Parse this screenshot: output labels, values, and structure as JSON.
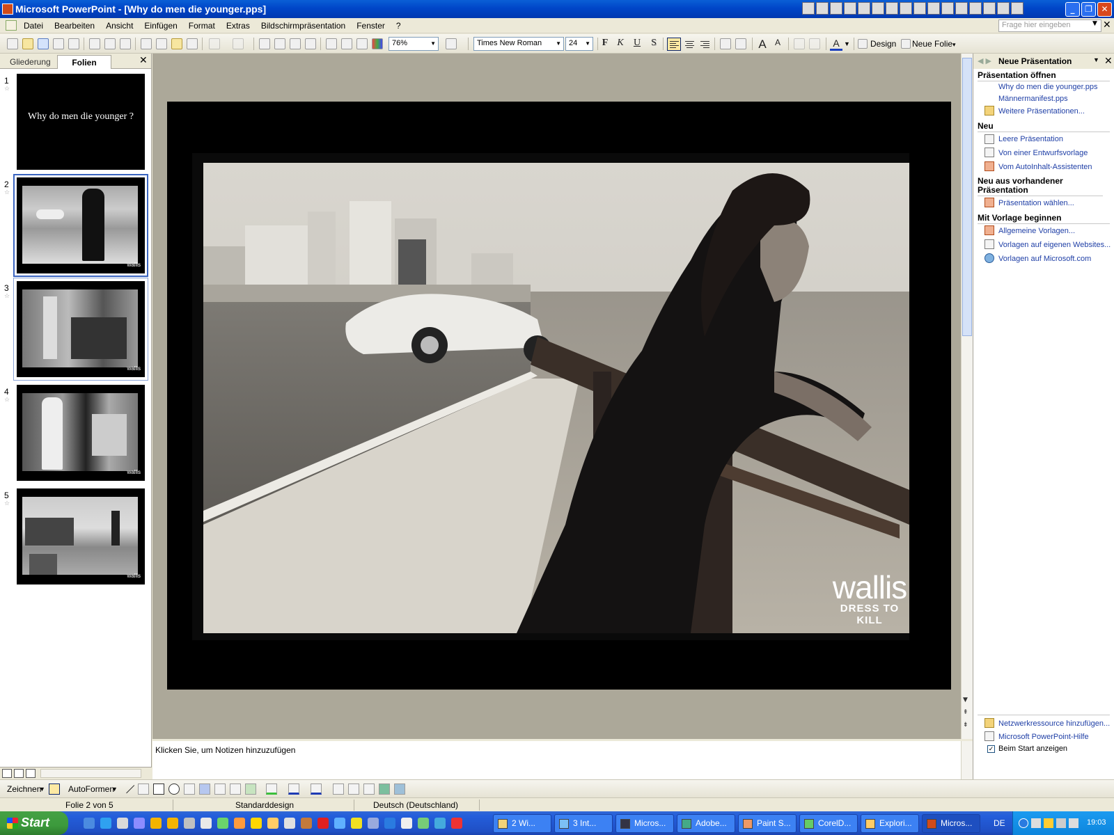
{
  "window": {
    "title": "Microsoft PowerPoint - [Why do men die younger.pps]",
    "minimize": "_",
    "restore": "❐",
    "close": "✕"
  },
  "menu": {
    "items": [
      "Datei",
      "Bearbeiten",
      "Ansicht",
      "Einfügen",
      "Format",
      "Extras",
      "Bildschirmpräsentation",
      "Fenster",
      "?"
    ],
    "help_placeholder": "Frage hier eingeben",
    "doc_close": "✕"
  },
  "toolbar": {
    "zoom": "76%",
    "font": "Times New Roman",
    "size": "24",
    "bold": "F",
    "italic": "K",
    "underline": "U",
    "shadow": "S",
    "grow_font": "A",
    "shrink_font": "A",
    "font_color": "A",
    "design": "Design",
    "new_slide": "Neue Folie"
  },
  "left_pane": {
    "tabs": [
      "Gliederung",
      "Folien"
    ],
    "close": "✕",
    "slides": [
      {
        "number": "1",
        "text": "Why do men die younger ?",
        "star": "☆"
      },
      {
        "number": "2",
        "text": "",
        "star": "☆",
        "logo": "wallis"
      },
      {
        "number": "3",
        "text": "",
        "star": "☆",
        "logo": "wallis"
      },
      {
        "number": "4",
        "text": "",
        "star": "☆",
        "logo": "wallis"
      },
      {
        "number": "5",
        "text": "",
        "star": "☆",
        "logo": "wallis"
      }
    ]
  },
  "slide": {
    "brand_name": "wallis",
    "brand_tagline": "DRESS TO KILL"
  },
  "notes": {
    "placeholder": "Klicken Sie, um Notizen hinzuzufügen"
  },
  "task_pane": {
    "title": "Neue Präsentation",
    "nav": "◀ ▶",
    "drop": "▼",
    "close": "✕",
    "sections": {
      "open": "Präsentation öffnen",
      "new": "Neu",
      "from_existing": "Neu aus vorhandener Präsentation",
      "from_template": "Mit Vorlage beginnen"
    },
    "open_links": [
      "Why do men die younger.pps",
      "Männermanifest.pps",
      "Weitere Präsentationen..."
    ],
    "new_links": [
      "Leere Präsentation",
      "Von einer Entwurfsvorlage",
      "Vom AutoInhalt-Assistenten"
    ],
    "existing_links": [
      "Präsentation wählen..."
    ],
    "template_links": [
      "Allgemeine Vorlagen...",
      "Vorlagen auf eigenen Websites...",
      "Vorlagen auf Microsoft.com"
    ],
    "bottom_links": [
      "Netzwerkressource hinzufügen...",
      "Microsoft PowerPoint-Hilfe"
    ],
    "show_at_startup": "Beim Start anzeigen",
    "show_at_startup_checked": true
  },
  "draw_toolbar": {
    "draw": "Zeichnen",
    "autoshapes": "AutoFormen"
  },
  "status": {
    "slide_position": "Folie 2 von 5",
    "design": "Standarddesign",
    "language": "Deutsch (Deutschland)"
  },
  "taskbar": {
    "start": "Start",
    "buttons": [
      "2 Wi...",
      "3 Int...",
      "Micros...",
      "Adobe...",
      "Paint S...",
      "CorelD...",
      "Explori...",
      "Micros..."
    ],
    "lang": "DE",
    "clock": "19:03"
  }
}
